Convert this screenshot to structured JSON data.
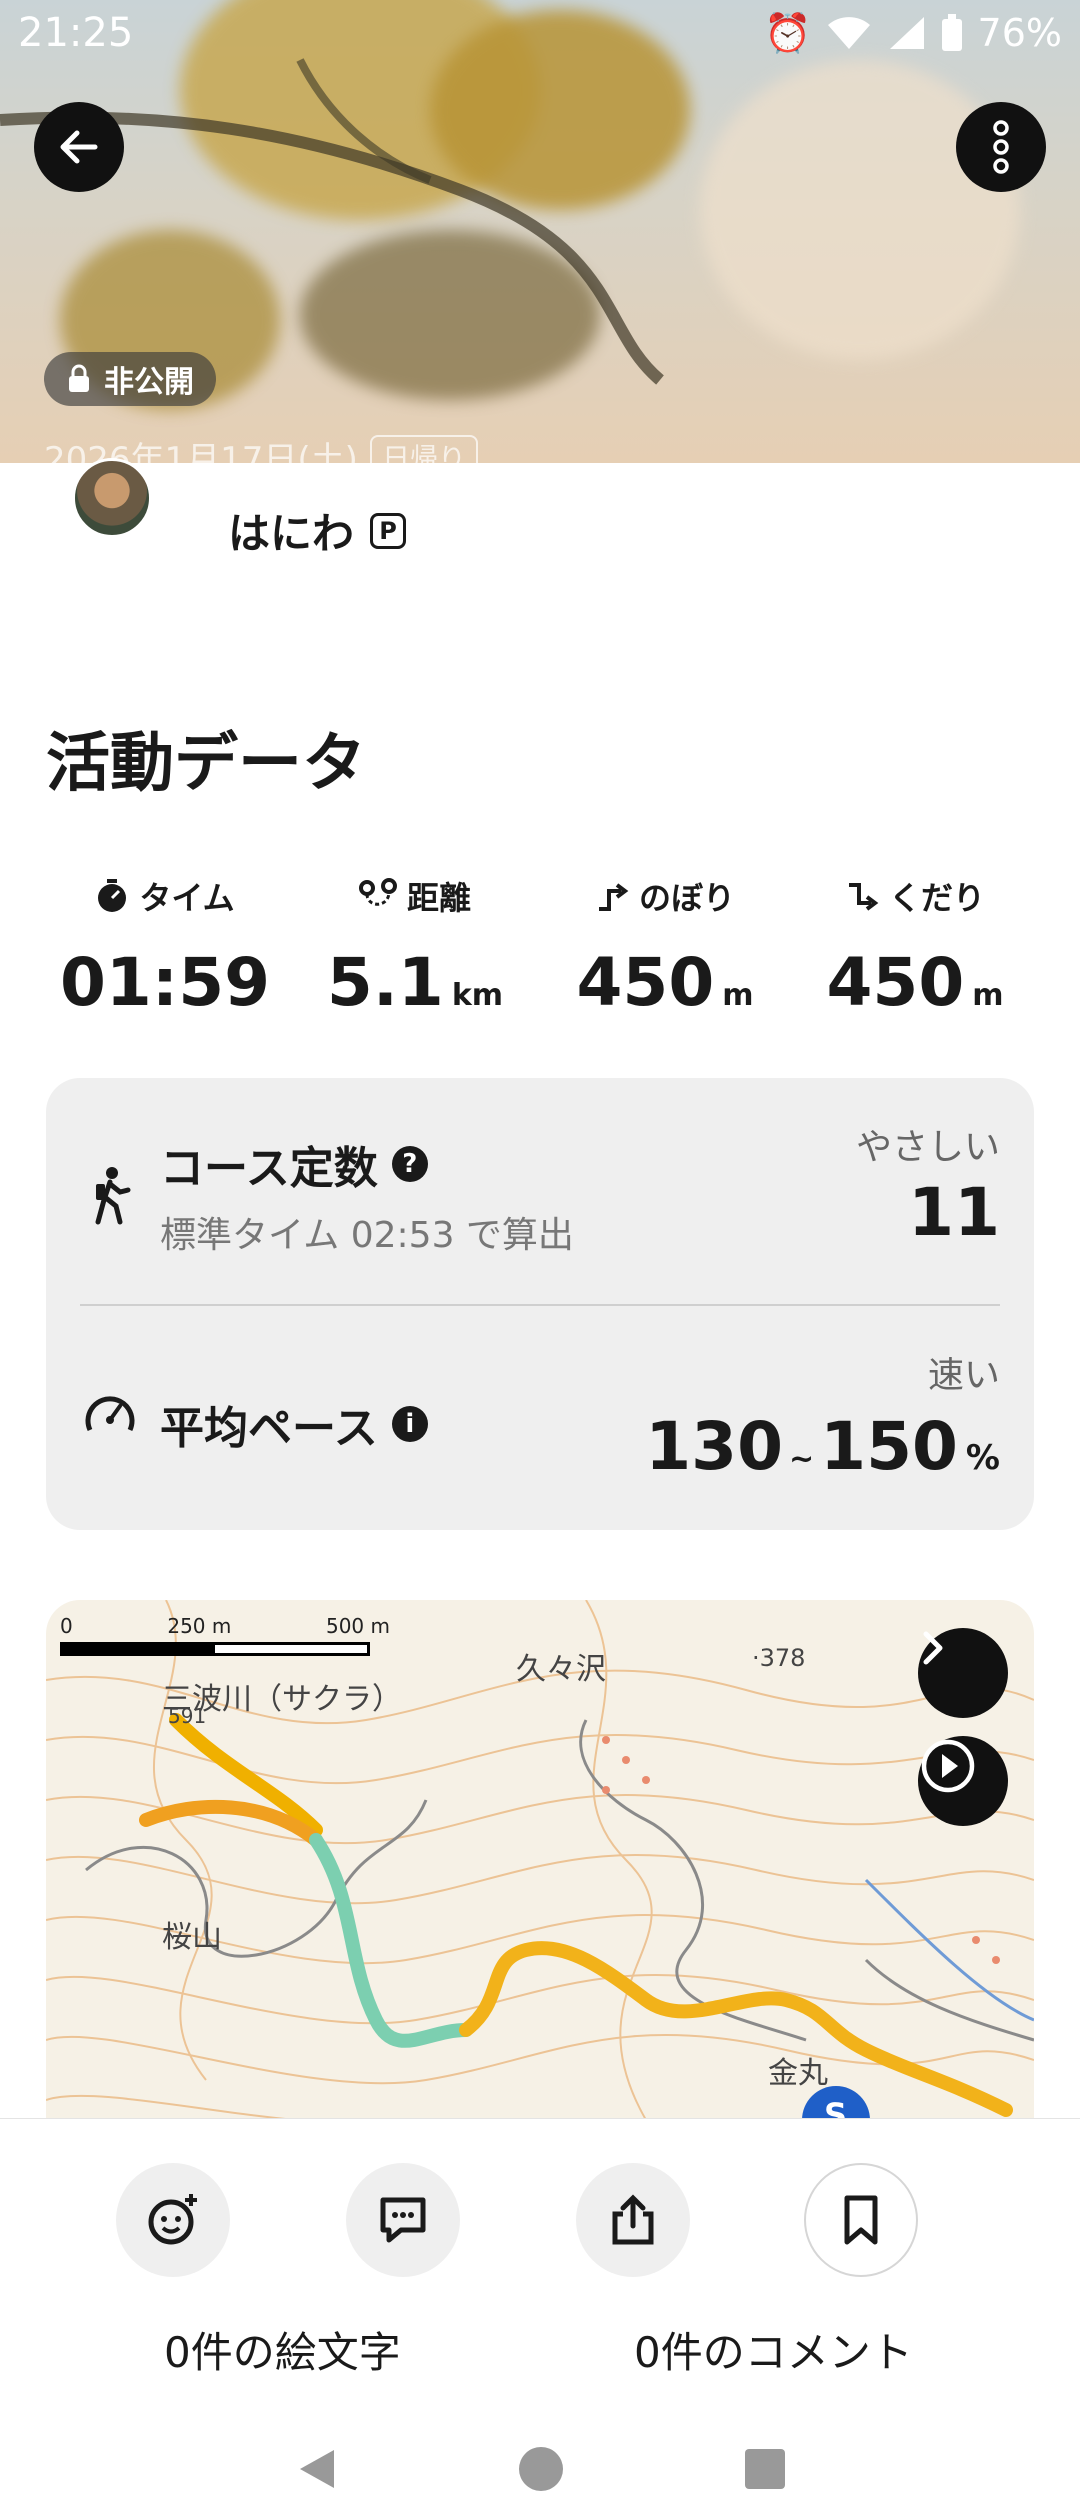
{
  "status_bar": {
    "time": "21:25",
    "battery": "76%"
  },
  "hero": {
    "privacy_label": "非公開",
    "date_text": "2026年1月17日(土)",
    "day_tag": "日帰り"
  },
  "user": {
    "name": "はにわ",
    "badge": "P"
  },
  "activity": {
    "title": "活動データ",
    "stats": [
      {
        "label": "タイム",
        "value": "01:59",
        "unit": "",
        "icon": "stopwatch-icon"
      },
      {
        "label": "距離",
        "value": "5.1",
        "unit": "km",
        "icon": "route-icon"
      },
      {
        "label": "のぼり",
        "value": "450",
        "unit": "m",
        "icon": "ascent-icon"
      },
      {
        "label": "くだり",
        "value": "450",
        "unit": "m",
        "icon": "descent-icon"
      }
    ]
  },
  "course": {
    "title": "コース定数",
    "subtitle": "標準タイム 02:53 で算出",
    "difficulty_label": "やさしい",
    "value": "11"
  },
  "pace": {
    "title": "平均ペース",
    "speed_label": "速い",
    "low": "130",
    "separator": "~",
    "high": "150",
    "unit": "%"
  },
  "map": {
    "scale_ticks": [
      "0",
      "250 m",
      "500 m"
    ],
    "labels": {
      "place1": "三波川（サクラ）",
      "place2": "久々沢",
      "place3": "桜山",
      "place4": "金丸",
      "elevation": "·378",
      "elevation2": "591"
    },
    "start_marker": "S"
  },
  "actions": {
    "emoji_count_label": "0件の絵文字",
    "comment_count_label": "0件のコメント"
  }
}
